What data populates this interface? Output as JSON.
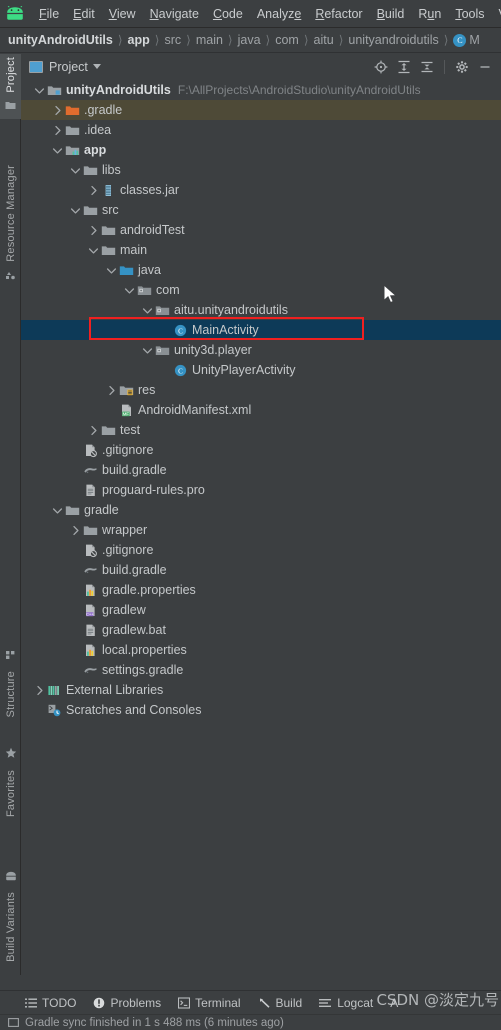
{
  "menubar": {
    "logo_icon": "android-logo-icon",
    "items": [
      {
        "label": "File",
        "mnemonic": 0
      },
      {
        "label": "Edit",
        "mnemonic": 0
      },
      {
        "label": "View",
        "mnemonic": 0
      },
      {
        "label": "Navigate",
        "mnemonic": 0
      },
      {
        "label": "Code",
        "mnemonic": 0
      },
      {
        "label": "Analyze",
        "mnemonic": 6
      },
      {
        "label": "Refactor",
        "mnemonic": 0
      },
      {
        "label": "Build",
        "mnemonic": 0
      },
      {
        "label": "Run",
        "mnemonic": 1
      },
      {
        "label": "Tools",
        "mnemonic": 0
      },
      {
        "label": "VC",
        "mnemonic": -1
      }
    ]
  },
  "breadcrumb": {
    "items": [
      "unityAndroidUtils",
      "app",
      "src",
      "main",
      "java",
      "com",
      "aitu",
      "unityandroidutils"
    ],
    "bold_count": 2,
    "trailing_class": "M",
    "trailing_class_icon": "class-icon"
  },
  "toolstrip": {
    "top_tabs": [
      {
        "label": "Project",
        "icon": "project-folder-icon",
        "active": true
      },
      {
        "label": "Resource Manager",
        "icon": "resource-manager-icon",
        "active": false
      }
    ],
    "bottom_tabs": [
      {
        "label": "Structure",
        "icon": "structure-icon",
        "active": false
      },
      {
        "label": "Favorites",
        "icon": "star-icon",
        "active": false
      },
      {
        "label": "Build Variants",
        "icon": "android-variant-icon",
        "active": false
      }
    ]
  },
  "panel": {
    "title": "Project",
    "title_icon": "project-window-icon",
    "dropdown_icon": "chevron-down-icon",
    "actions": [
      {
        "name": "locate-icon",
        "title": "Select Opened File"
      },
      {
        "name": "expand-all-icon",
        "title": "Expand All"
      },
      {
        "name": "collapse-all-icon",
        "title": "Collapse All"
      },
      {
        "name": "gear-icon",
        "title": "Settings"
      },
      {
        "name": "minimize-icon",
        "title": "Hide"
      }
    ]
  },
  "tree": {
    "rows": [
      {
        "label": "unityAndroidUtils",
        "sublabel": "F:\\AllProjects\\AndroidStudio\\unityAndroidUtils",
        "depth": 0,
        "arrow": "down",
        "icon": "module-folder-icon",
        "bold": true,
        "state": "none"
      },
      {
        "label": ".gradle",
        "sublabel": "",
        "depth": 1,
        "arrow": "right",
        "icon": "orange-folder-icon",
        "bold": false,
        "state": "hover"
      },
      {
        "label": ".idea",
        "sublabel": "",
        "depth": 1,
        "arrow": "right",
        "icon": "folder-icon",
        "bold": false,
        "state": "none"
      },
      {
        "label": "app",
        "sublabel": "",
        "depth": 1,
        "arrow": "down",
        "icon": "module-app-icon",
        "bold": true,
        "state": "none"
      },
      {
        "label": "libs",
        "sublabel": "",
        "depth": 2,
        "arrow": "down",
        "icon": "folder-icon",
        "bold": false,
        "state": "none"
      },
      {
        "label": "classes.jar",
        "sublabel": "",
        "depth": 3,
        "arrow": "right",
        "icon": "jar-icon",
        "bold": false,
        "state": "none"
      },
      {
        "label": "src",
        "sublabel": "",
        "depth": 2,
        "arrow": "down",
        "icon": "folder-icon",
        "bold": false,
        "state": "none"
      },
      {
        "label": "androidTest",
        "sublabel": "",
        "depth": 3,
        "arrow": "right",
        "icon": "folder-icon",
        "bold": false,
        "state": "none"
      },
      {
        "label": "main",
        "sublabel": "",
        "depth": 3,
        "arrow": "down",
        "icon": "folder-icon",
        "bold": false,
        "state": "none"
      },
      {
        "label": "java",
        "sublabel": "",
        "depth": 4,
        "arrow": "down",
        "icon": "source-folder-icon",
        "bold": false,
        "state": "none"
      },
      {
        "label": "com",
        "sublabel": "",
        "depth": 5,
        "arrow": "down",
        "icon": "package-icon",
        "bold": false,
        "state": "none"
      },
      {
        "label": "aitu.unityandroidutils",
        "sublabel": "",
        "depth": 6,
        "arrow": "down",
        "icon": "package-icon",
        "bold": false,
        "state": "none"
      },
      {
        "label": "MainActivity",
        "sublabel": "",
        "depth": 7,
        "arrow": "none",
        "icon": "class-icon",
        "bold": false,
        "state": "selected"
      },
      {
        "label": "unity3d.player",
        "sublabel": "",
        "depth": 6,
        "arrow": "down",
        "icon": "package-icon",
        "bold": false,
        "state": "none"
      },
      {
        "label": "UnityPlayerActivity",
        "sublabel": "",
        "depth": 7,
        "arrow": "none",
        "icon": "class-icon",
        "bold": false,
        "state": "none"
      },
      {
        "label": "res",
        "sublabel": "",
        "depth": 4,
        "arrow": "right",
        "icon": "res-folder-icon",
        "bold": false,
        "state": "none"
      },
      {
        "label": "AndroidManifest.xml",
        "sublabel": "",
        "depth": 4,
        "arrow": "none",
        "icon": "manifest-icon",
        "bold": false,
        "state": "none"
      },
      {
        "label": "test",
        "sublabel": "",
        "depth": 3,
        "arrow": "right",
        "icon": "folder-icon",
        "bold": false,
        "state": "none"
      },
      {
        "label": ".gitignore",
        "sublabel": "",
        "depth": 2,
        "arrow": "none",
        "icon": "gitignore-icon",
        "bold": false,
        "state": "none"
      },
      {
        "label": "build.gradle",
        "sublabel": "",
        "depth": 2,
        "arrow": "none",
        "icon": "gradle-icon",
        "bold": false,
        "state": "none"
      },
      {
        "label": "proguard-rules.pro",
        "sublabel": "",
        "depth": 2,
        "arrow": "none",
        "icon": "text-file-icon",
        "bold": false,
        "state": "none"
      },
      {
        "label": "gradle",
        "sublabel": "",
        "depth": 1,
        "arrow": "down",
        "icon": "folder-icon",
        "bold": false,
        "state": "none"
      },
      {
        "label": "wrapper",
        "sublabel": "",
        "depth": 2,
        "arrow": "right",
        "icon": "folder-icon",
        "bold": false,
        "state": "none"
      },
      {
        "label": ".gitignore",
        "sublabel": "",
        "depth": 2,
        "arrow": "none",
        "icon": "gitignore-icon",
        "bold": false,
        "state": "none"
      },
      {
        "label": "build.gradle",
        "sublabel": "",
        "depth": 2,
        "arrow": "none",
        "icon": "gradle-icon",
        "bold": false,
        "state": "none"
      },
      {
        "label": "gradle.properties",
        "sublabel": "",
        "depth": 2,
        "arrow": "none",
        "icon": "properties-icon",
        "bold": false,
        "state": "none"
      },
      {
        "label": "gradlew",
        "sublabel": "",
        "depth": 2,
        "arrow": "none",
        "icon": "cpp-file-icon",
        "bold": false,
        "state": "none"
      },
      {
        "label": "gradlew.bat",
        "sublabel": "",
        "depth": 2,
        "arrow": "none",
        "icon": "text-file-icon",
        "bold": false,
        "state": "none"
      },
      {
        "label": "local.properties",
        "sublabel": "",
        "depth": 2,
        "arrow": "none",
        "icon": "properties-icon",
        "bold": false,
        "state": "none"
      },
      {
        "label": "settings.gradle",
        "sublabel": "",
        "depth": 2,
        "arrow": "none",
        "icon": "gradle-icon",
        "bold": false,
        "state": "none"
      },
      {
        "label": "External Libraries",
        "sublabel": "",
        "depth": 0,
        "arrow": "right",
        "icon": "libraries-icon",
        "bold": false,
        "state": "none"
      },
      {
        "label": "Scratches and Consoles",
        "sublabel": "",
        "depth": 0,
        "arrow": "none",
        "icon": "scratches-icon",
        "bold": false,
        "state": "none"
      }
    ]
  },
  "annotation": {
    "color": "#ef2020",
    "target_row": "MainActivity"
  },
  "bottom_bar": {
    "items": [
      {
        "label": "TODO",
        "icon": "todo-list-icon"
      },
      {
        "label": "Problems",
        "icon": "problems-icon"
      },
      {
        "label": "Terminal",
        "icon": "terminal-icon"
      },
      {
        "label": "Build",
        "icon": "build-hammer-icon"
      },
      {
        "label": "Logcat",
        "icon": "logcat-icon"
      },
      {
        "label": "A",
        "icon": "app-inspection-icon"
      }
    ]
  },
  "status": {
    "text": "Gradle sync finished in 1 s 488 ms (6 minutes ago)",
    "icon": "event-log-icon"
  },
  "watermark": {
    "text": "CSDN @淡定九号"
  },
  "colors": {
    "background": "#3c3f41",
    "selection": "#0d3a58",
    "hover": "#4e4a37",
    "accent": "#3592c4",
    "annotation": "#ef2020",
    "text": "#c5c8ca",
    "muted": "#808487"
  }
}
